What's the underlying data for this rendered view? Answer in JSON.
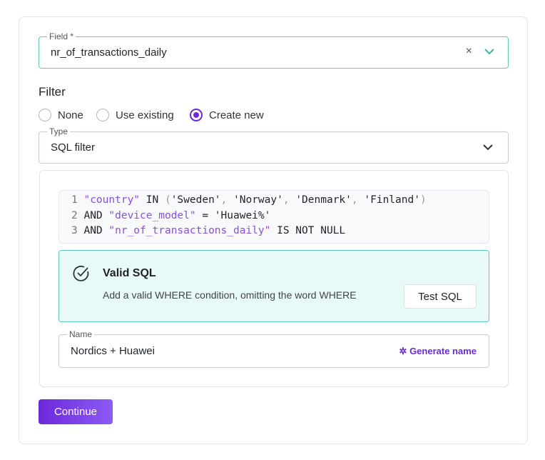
{
  "field": {
    "label": "Field *",
    "value": "nr_of_transactions_daily"
  },
  "filter": {
    "heading": "Filter",
    "options": [
      "None",
      "Use existing",
      "Create new"
    ],
    "selected": "Create new"
  },
  "type": {
    "label": "Type",
    "value": "SQL filter"
  },
  "sql": {
    "lines": [
      {
        "n": "1",
        "parts": [
          [
            "s",
            "\"country\""
          ],
          [
            "k",
            " IN "
          ],
          [
            "p",
            "("
          ],
          [
            "k",
            "'Sweden'"
          ],
          [
            "p",
            ", "
          ],
          [
            "k",
            "'Norway'"
          ],
          [
            "p",
            ", "
          ],
          [
            "k",
            "'Denmark'"
          ],
          [
            "p",
            ", "
          ],
          [
            "k",
            "'Finland'"
          ],
          [
            "p",
            ")"
          ]
        ]
      },
      {
        "n": "2",
        "parts": [
          [
            "k",
            "AND "
          ],
          [
            "s",
            "\"device_model\""
          ],
          [
            "k",
            " = 'Huawei%'"
          ]
        ]
      },
      {
        "n": "3",
        "parts": [
          [
            "k",
            "AND "
          ],
          [
            "s",
            "\"nr_of_transactions_daily\""
          ],
          [
            "k",
            " IS NOT NULL"
          ]
        ]
      }
    ]
  },
  "validation": {
    "title": "Valid SQL",
    "hint": "Add a valid WHERE condition, omitting the word WHERE",
    "test_button": "Test SQL"
  },
  "name": {
    "label": "Name",
    "value": "Nordics + Huawei",
    "generate": "Generate name"
  },
  "continue": "Continue",
  "colors": {
    "accent": "#6d28d9",
    "teal": "#5ecabb"
  }
}
